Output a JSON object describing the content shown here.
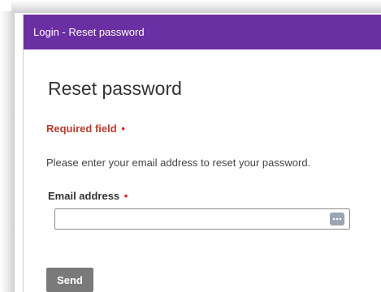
{
  "window": {
    "title": "Login - Reset password",
    "title_bar_color": "#6b2fa4"
  },
  "page": {
    "heading": "Reset password",
    "required_note": "Required field",
    "required_marker": "•",
    "instruction": "Please enter your email address to reset your password."
  },
  "form": {
    "email_label": "Email address",
    "email_required_marker": "•",
    "email_value": "",
    "email_placeholder": "",
    "autofill_icon": "password-manager-dots-icon",
    "send_label": "Send"
  },
  "colors": {
    "required": "#c0392b",
    "button": "#7a7a7a"
  }
}
